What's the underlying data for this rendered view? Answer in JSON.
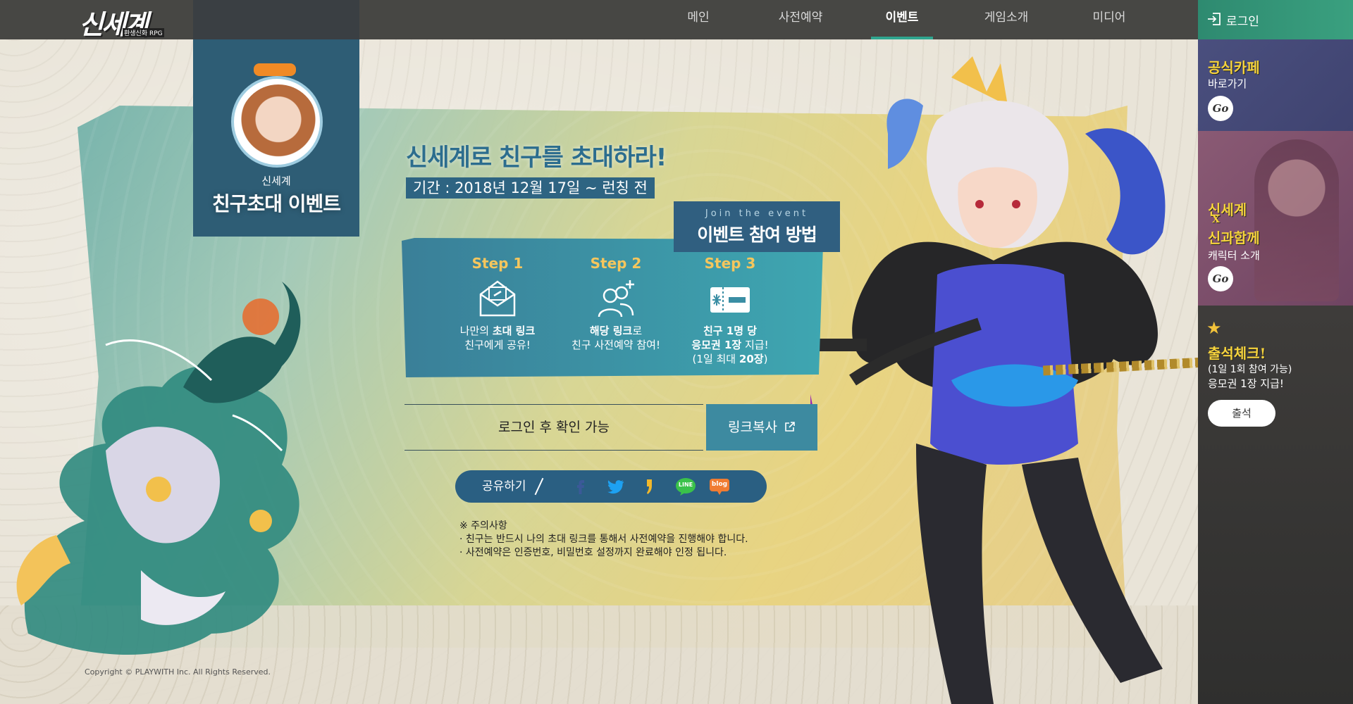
{
  "header": {
    "logo_text": "신세계",
    "logo_sub": "환생신화 RPG",
    "nav": [
      {
        "label": "메인"
      },
      {
        "label": "사전예약"
      },
      {
        "label": "이벤트"
      },
      {
        "label": "게임소개"
      },
      {
        "label": "미디어"
      }
    ],
    "active_nav": "이벤트"
  },
  "sidebar": {
    "login_label": "로그인",
    "cafe": {
      "title": "공식카페",
      "sub": "바로가기",
      "go": "Go"
    },
    "collab": {
      "title_line1": "신세계",
      "title_x": "X",
      "title_line2": "신과함께",
      "sub": "캐릭터 소개",
      "go": "Go"
    },
    "attendance": {
      "title": "출석체크!",
      "line1": "(1일 1회 참여 가능)",
      "line2": "응모권 1장 지급!",
      "button": "출석"
    }
  },
  "badge": {
    "small": "신세계",
    "big": "친구초대 이벤트"
  },
  "event": {
    "headline": "신세계로 친구를 초대하라!",
    "period": "기간 : 2018년 12월 17일 ~ 런칭 전",
    "howto_en": "Join the event",
    "howto_ko": "이벤트 참여 방법",
    "steps": [
      {
        "title": "Step 1",
        "icon": "envelope-link-icon",
        "line1_pre": "나만의 ",
        "line1_bold": "초대 링크",
        "line2": "친구에게 공유!"
      },
      {
        "title": "Step 2",
        "icon": "add-friends-icon",
        "line1_bold": "해당 링크",
        "line1_post": "로",
        "line2": "친구 사전예약 참여!"
      },
      {
        "title": "Step 3",
        "icon": "ticket-icon",
        "line1": "친구 1명 당",
        "line2_bold": "응모권 1장",
        "line2_post": " 지급!",
        "line3_pre": "(1일 최대 ",
        "line3_bold": "20장",
        "line3_post": ")"
      }
    ],
    "link_field": "로그인 후 확인 가능",
    "link_copy": "링크복사",
    "share_label": "공유하기",
    "share_icons": [
      "facebook-icon",
      "twitter-icon",
      "kakaostory-icon",
      "line-icon",
      "blog-icon"
    ],
    "share_line_text": "LINE",
    "share_blog_text": "blog",
    "notice_title": "※ 주의사항",
    "notice_items": [
      "· 친구는 반드시 나의 초대 링크를 통해서 사전예약을 진행해야 합니다.",
      "· 사전예약은 인증번호, 비밀번호 설정까지 완료해야 인정 됩니다."
    ]
  },
  "footer": {
    "copyright": "Copyright © PLAYWITH Inc. All Rights Reserved."
  },
  "colors": {
    "accent_green": "#2fa58f",
    "step_gold": "#f5c65d",
    "nav_bg": "#474744",
    "badge_blue": "#2e5d75"
  }
}
